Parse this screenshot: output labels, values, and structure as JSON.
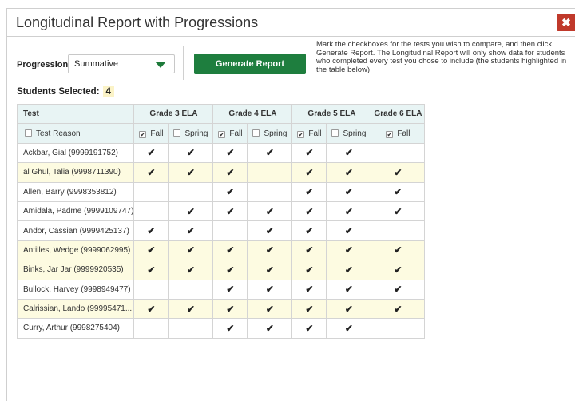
{
  "dialog": {
    "title": "Longitudinal Report with Progressions",
    "close_icon": "✖"
  },
  "controls": {
    "progression_label": "Progression",
    "progression_value": "Summative",
    "generate_label": "Generate Report",
    "instructions": "Mark the checkboxes for the tests you wish to compare, and then click Generate Report. The Longitudinal Report will only show data for students who completed every test you chose to include (the students highlighted in the table below)."
  },
  "students_selected": {
    "label": "Students Selected:",
    "count": "4"
  },
  "table": {
    "test_header": "Test",
    "reason_label": "Test Reason",
    "grades": [
      "Grade 3 ELA",
      "Grade 4 ELA",
      "Grade 5 ELA",
      "Grade 6 ELA"
    ],
    "terms": [
      {
        "label": "Fall",
        "checked": true
      },
      {
        "label": "Spring",
        "checked": false
      },
      {
        "label": "Fall",
        "checked": true
      },
      {
        "label": "Spring",
        "checked": false
      },
      {
        "label": "Fall",
        "checked": true
      },
      {
        "label": "Spring",
        "checked": false
      },
      {
        "label": "Fall",
        "checked": true
      }
    ],
    "rows": [
      {
        "name": "Ackbar, Gial (9999191752)",
        "highlighted": false,
        "checks": [
          1,
          1,
          1,
          1,
          1,
          1,
          0
        ]
      },
      {
        "name": "al Ghul, Talia (9998711390)",
        "highlighted": true,
        "checks": [
          1,
          1,
          1,
          0,
          1,
          1,
          1
        ]
      },
      {
        "name": "Allen, Barry (9998353812)",
        "highlighted": false,
        "checks": [
          0,
          0,
          1,
          0,
          1,
          1,
          1
        ]
      },
      {
        "name": "Amidala, Padme (9999109747)",
        "highlighted": false,
        "checks": [
          0,
          1,
          1,
          1,
          1,
          1,
          1
        ]
      },
      {
        "name": "Andor, Cassian (9999425137)",
        "highlighted": false,
        "checks": [
          1,
          1,
          0,
          1,
          1,
          1,
          0
        ]
      },
      {
        "name": "Antilles, Wedge (9999062995)",
        "highlighted": true,
        "checks": [
          1,
          1,
          1,
          1,
          1,
          1,
          1
        ]
      },
      {
        "name": "Binks, Jar Jar (9999920535)",
        "highlighted": true,
        "checks": [
          1,
          1,
          1,
          1,
          1,
          1,
          1
        ]
      },
      {
        "name": "Bullock, Harvey (9998949477)",
        "highlighted": false,
        "checks": [
          0,
          0,
          1,
          1,
          1,
          1,
          1
        ]
      },
      {
        "name": "Calrissian, Lando (99995471...",
        "highlighted": true,
        "checks": [
          1,
          1,
          1,
          1,
          1,
          1,
          1
        ]
      },
      {
        "name": "Curry, Arthur (9998275404)",
        "highlighted": false,
        "checks": [
          0,
          0,
          1,
          1,
          1,
          1,
          0
        ]
      }
    ],
    "check_glyph": "✔"
  }
}
